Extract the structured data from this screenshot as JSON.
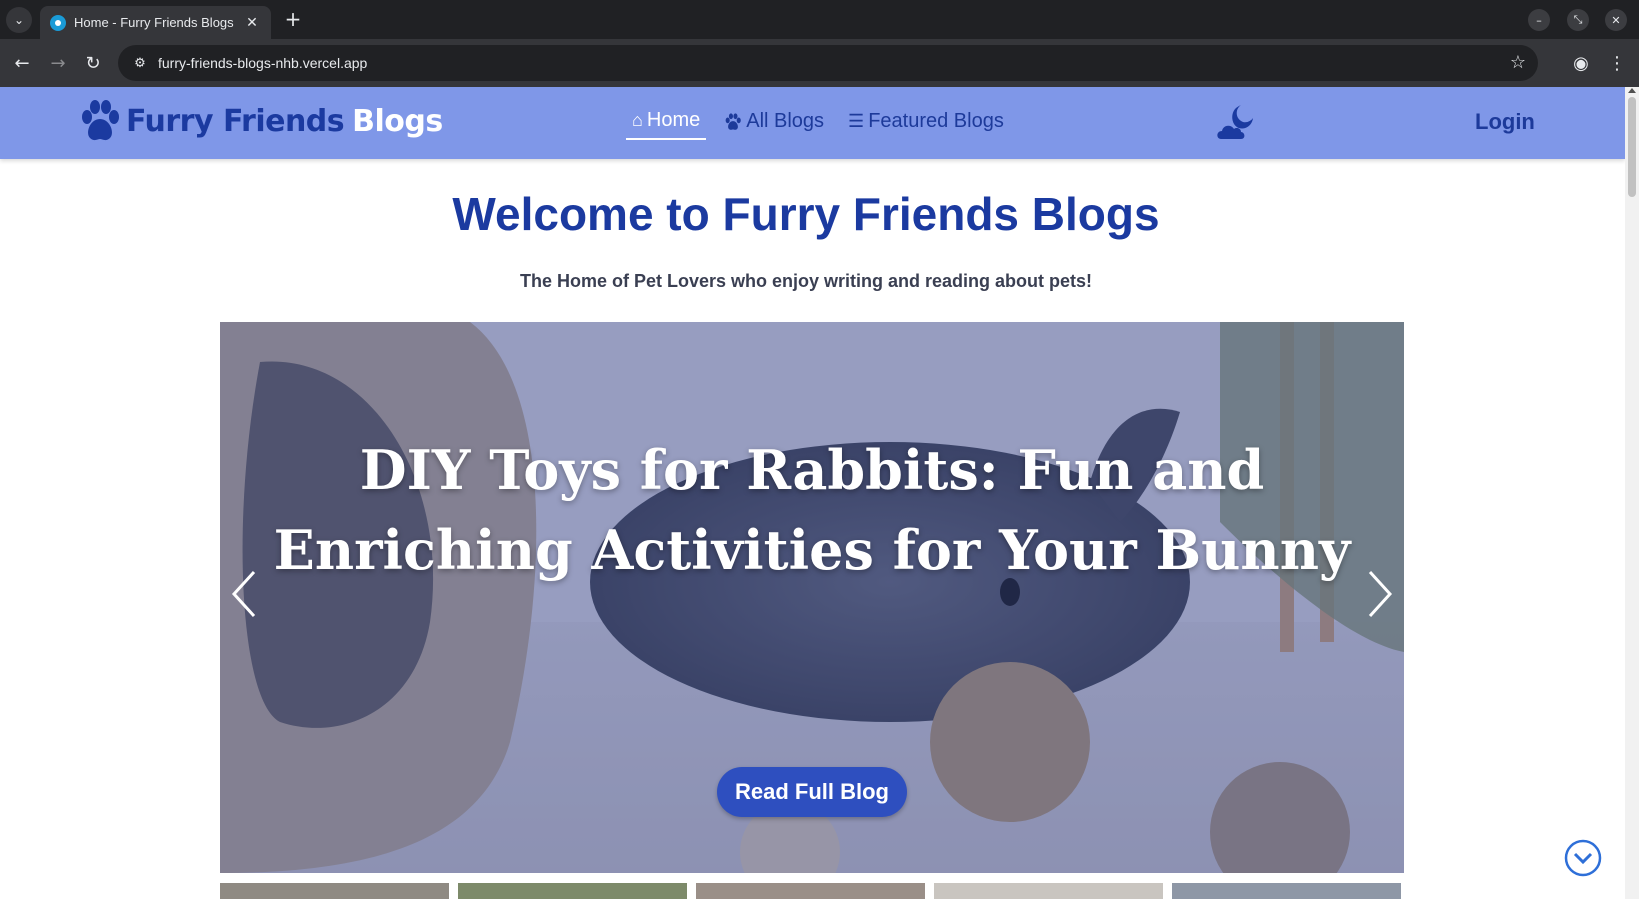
{
  "browser": {
    "tab_title": "Home - Furry Friends Blogs",
    "url": "furry-friends-blogs-nhb.vercel.app"
  },
  "nav": {
    "brand_part1": "Furry Friends",
    "brand_part2": "Blogs",
    "links": [
      {
        "label": "Home",
        "icon": "home-icon",
        "active": true
      },
      {
        "label": "All Blogs",
        "icon": "paw-icon",
        "active": false
      },
      {
        "label": "Featured Blogs",
        "icon": "list-icon",
        "active": false
      }
    ],
    "login": "Login",
    "theme_icon": "moon-cloud-icon"
  },
  "hero": {
    "title": "Welcome to Furry Friends Blogs",
    "tagline": "The Home of Pet Lovers who enjoy writing and reading about pets!"
  },
  "carousel": {
    "slide_title": "DIY Toys for Rabbits: Fun and Enriching Activities for Your Bunny",
    "button_label": "Read Full Blog"
  },
  "colors": {
    "navbar": "#7f97e8",
    "brand_blue": "#1b3aa0",
    "button_blue": "#2e4fbf"
  }
}
